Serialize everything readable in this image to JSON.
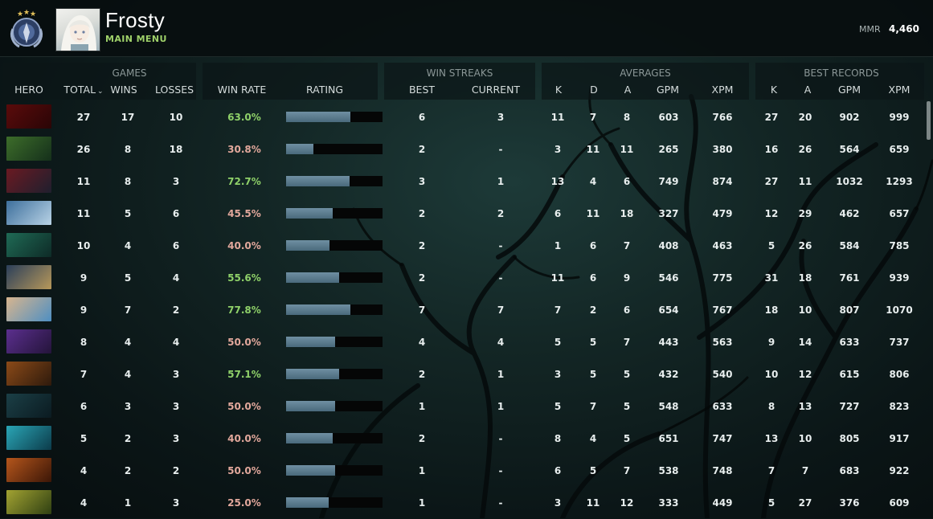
{
  "profile": {
    "name": "Frosty",
    "subtitle": "MAIN MENU",
    "mmr_label": "MMR",
    "mmr_value": "4,460"
  },
  "groups": {
    "games": "GAMES",
    "win_streaks": "WIN STREAKS",
    "averages": "AVERAGES",
    "best_records": "BEST RECORDS"
  },
  "columns": {
    "hero": "HERO",
    "total": "TOTAL",
    "wins": "WINS",
    "losses": "LOSSES",
    "win_rate": "WIN RATE",
    "rating": "RATING",
    "best": "BEST",
    "current": "CURRENT",
    "k": "K",
    "d": "D",
    "a": "A",
    "gpm": "GPM",
    "xpm": "XPM",
    "rec_k": "K",
    "rec_a": "A",
    "rec_gpm": "GPM",
    "rec_xpm": "XPM"
  },
  "colors": {
    "win_rate_good": "#8fd169",
    "win_rate_bad": "#e2a89c",
    "rating_fill": "#5f7f91",
    "accent_green": "#9fd16a"
  },
  "rows": [
    {
      "hero_icon": "hero-red-demon",
      "c1": "#5a0b0b",
      "c2": "#2a0506",
      "total": "27",
      "wins": "17",
      "losses": "10",
      "win_rate": "63.0%",
      "good": true,
      "rating": 0.67,
      "best": "6",
      "current": "3",
      "k": "11",
      "d": "7",
      "a": "8",
      "gpm": "603",
      "xpm": "766",
      "rk": "27",
      "ra": "20",
      "rgpm": "902",
      "rxpm": "999"
    },
    {
      "hero_icon": "hero-green-goblin",
      "c1": "#3d6d2a",
      "c2": "#15301b",
      "total": "26",
      "wins": "8",
      "losses": "18",
      "win_rate": "30.8%",
      "good": false,
      "rating": 0.28,
      "best": "2",
      "current": "-",
      "k": "3",
      "d": "11",
      "a": "11",
      "gpm": "265",
      "xpm": "380",
      "rk": "16",
      "ra": "26",
      "rgpm": "564",
      "rxpm": "659"
    },
    {
      "hero_icon": "hero-red-masked",
      "c1": "#6a1a22",
      "c2": "#1f1f2e",
      "total": "11",
      "wins": "8",
      "losses": "3",
      "win_rate": "72.7%",
      "good": true,
      "rating": 0.66,
      "best": "3",
      "current": "1",
      "k": "13",
      "d": "4",
      "a": "6",
      "gpm": "749",
      "xpm": "874",
      "rk": "27",
      "ra": "11",
      "rgpm": "1032",
      "rxpm": "1293"
    },
    {
      "hero_icon": "hero-blue-storm",
      "c1": "#3d6f9c",
      "c2": "#b9d3e6",
      "total": "11",
      "wins": "5",
      "losses": "6",
      "win_rate": "45.5%",
      "good": false,
      "rating": 0.48,
      "best": "2",
      "current": "2",
      "k": "6",
      "d": "11",
      "a": "18",
      "gpm": "327",
      "xpm": "479",
      "rk": "12",
      "ra": "29",
      "rgpm": "462",
      "rxpm": "657"
    },
    {
      "hero_icon": "hero-green-undead",
      "c1": "#1f6a55",
      "c2": "#0e2b27",
      "total": "10",
      "wins": "4",
      "losses": "6",
      "win_rate": "40.0%",
      "good": false,
      "rating": 0.45,
      "best": "2",
      "current": "-",
      "k": "1",
      "d": "6",
      "a": "7",
      "gpm": "408",
      "xpm": "463",
      "rk": "5",
      "ra": "26",
      "rgpm": "584",
      "rxpm": "785"
    },
    {
      "hero_icon": "hero-tinker",
      "c1": "#2b3f5a",
      "c2": "#b7985a",
      "total": "9",
      "wins": "5",
      "losses": "4",
      "win_rate": "55.6%",
      "good": true,
      "rating": 0.55,
      "best": "2",
      "current": "-",
      "k": "11",
      "d": "6",
      "a": "9",
      "gpm": "546",
      "xpm": "775",
      "rk": "31",
      "ra": "18",
      "rgpm": "761",
      "rxpm": "939"
    },
    {
      "hero_icon": "hero-crystal-maiden",
      "c1": "#d8b58e",
      "c2": "#4e8fc2",
      "total": "9",
      "wins": "7",
      "losses": "2",
      "win_rate": "77.8%",
      "good": true,
      "rating": 0.67,
      "best": "7",
      "current": "7",
      "k": "7",
      "d": "2",
      "a": "6",
      "gpm": "654",
      "xpm": "767",
      "rk": "18",
      "ra": "10",
      "rgpm": "807",
      "rxpm": "1070"
    },
    {
      "hero_icon": "hero-purple-void",
      "c1": "#5b2f8e",
      "c2": "#24143a",
      "total": "8",
      "wins": "4",
      "losses": "4",
      "win_rate": "50.0%",
      "good": false,
      "rating": 0.51,
      "best": "4",
      "current": "4",
      "k": "5",
      "d": "5",
      "a": "7",
      "gpm": "443",
      "xpm": "563",
      "rk": "9",
      "ra": "14",
      "rgpm": "633",
      "rxpm": "737"
    },
    {
      "hero_icon": "hero-orange-brute",
      "c1": "#8b4a18",
      "c2": "#2e1a0c",
      "total": "7",
      "wins": "4",
      "losses": "3",
      "win_rate": "57.1%",
      "good": true,
      "rating": 0.55,
      "best": "2",
      "current": "1",
      "k": "3",
      "d": "5",
      "a": "5",
      "gpm": "432",
      "xpm": "540",
      "rk": "10",
      "ra": "12",
      "rgpm": "615",
      "rxpm": "806"
    },
    {
      "hero_icon": "hero-teal-hooded",
      "c1": "#1b3f46",
      "c2": "#0b1b21",
      "total": "6",
      "wins": "3",
      "losses": "3",
      "win_rate": "50.0%",
      "good": false,
      "rating": 0.51,
      "best": "1",
      "current": "1",
      "k": "5",
      "d": "7",
      "a": "5",
      "gpm": "548",
      "xpm": "633",
      "rk": "8",
      "ra": "13",
      "rgpm": "727",
      "rxpm": "823"
    },
    {
      "hero_icon": "hero-water-spirit",
      "c1": "#2aa6b6",
      "c2": "#0c3b4a",
      "total": "5",
      "wins": "2",
      "losses": "3",
      "win_rate": "40.0%",
      "good": false,
      "rating": 0.48,
      "best": "2",
      "current": "-",
      "k": "8",
      "d": "4",
      "a": "5",
      "gpm": "651",
      "xpm": "747",
      "rk": "13",
      "ra": "10",
      "rgpm": "805",
      "rxpm": "917"
    },
    {
      "hero_icon": "hero-orange-demon",
      "c1": "#b5561c",
      "c2": "#3b1607",
      "total": "4",
      "wins": "2",
      "losses": "2",
      "win_rate": "50.0%",
      "good": false,
      "rating": 0.51,
      "best": "1",
      "current": "-",
      "k": "6",
      "d": "5",
      "a": "7",
      "gpm": "538",
      "xpm": "748",
      "rk": "7",
      "ra": "7",
      "rgpm": "683",
      "rxpm": "922"
    },
    {
      "hero_icon": "hero-yellow-goblin",
      "c1": "#a3a332",
      "c2": "#2e3f12",
      "total": "4",
      "wins": "1",
      "losses": "3",
      "win_rate": "25.0%",
      "good": false,
      "rating": 0.44,
      "best": "1",
      "current": "-",
      "k": "3",
      "d": "11",
      "a": "12",
      "gpm": "333",
      "xpm": "449",
      "rk": "5",
      "ra": "27",
      "rgpm": "376",
      "rxpm": "609"
    }
  ]
}
